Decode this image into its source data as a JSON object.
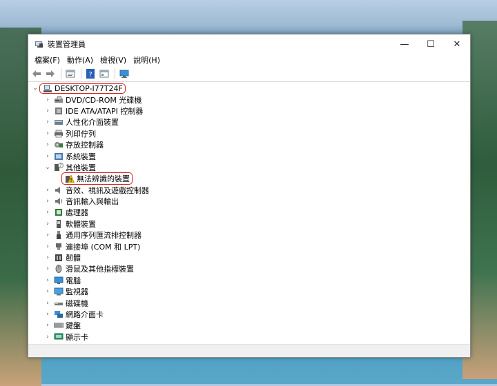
{
  "window": {
    "title": "裝置管理員",
    "controls": {
      "minimize": "—",
      "maximize": "☐",
      "close": "✕"
    }
  },
  "menu": [
    "檔案(F)",
    "動作(A)",
    "檢視(V)",
    "說明(H)"
  ],
  "toolbar": [
    "back-arrow-icon",
    "forward-arrow-icon",
    "properties-icon",
    "help-icon",
    "view-icon",
    "monitor-scan-icon"
  ],
  "tree": {
    "root": "DESKTOP-I77T24F",
    "items": [
      {
        "label": "DVD/CD-ROM 光碟機",
        "icon": "dvd-drive-icon",
        "expanded": false
      },
      {
        "label": "IDE ATA/ATAPI 控制器",
        "icon": "ide-controller-icon",
        "expanded": false
      },
      {
        "label": "人性化介面裝置",
        "icon": "hid-icon",
        "expanded": false
      },
      {
        "label": "列印佇列",
        "icon": "printer-icon",
        "expanded": false
      },
      {
        "label": "存放控制器",
        "icon": "storage-controller-icon",
        "expanded": false
      },
      {
        "label": "系統裝置",
        "icon": "system-device-icon",
        "expanded": false
      },
      {
        "label": "其他裝置",
        "icon": "other-devices-icon",
        "expanded": true,
        "children": [
          {
            "label": "無法辨識的裝置",
            "icon": "warning-device-icon"
          }
        ]
      },
      {
        "label": "音效、視訊及遊戲控制器",
        "icon": "speaker-icon",
        "expanded": false
      },
      {
        "label": "音訊輸入與輸出",
        "icon": "audio-io-icon",
        "expanded": false
      },
      {
        "label": "處理器",
        "icon": "processor-icon",
        "expanded": false
      },
      {
        "label": "軟體裝置",
        "icon": "software-device-icon",
        "expanded": false
      },
      {
        "label": "通用序列匯流排控制器",
        "icon": "usb-icon",
        "expanded": false
      },
      {
        "label": "連接埠 (COM 和 LPT)",
        "icon": "port-icon",
        "expanded": false
      },
      {
        "label": "韌體",
        "icon": "firmware-icon",
        "expanded": false
      },
      {
        "label": "滑鼠及其他指標裝置",
        "icon": "mouse-icon",
        "expanded": false
      },
      {
        "label": "電腦",
        "icon": "computer-icon",
        "expanded": false
      },
      {
        "label": "監視器",
        "icon": "monitor-icon",
        "expanded": false
      },
      {
        "label": "磁碟機",
        "icon": "disk-drive-icon",
        "expanded": false
      },
      {
        "label": "網路介面卡",
        "icon": "network-adapter-icon",
        "expanded": false
      },
      {
        "label": "鍵盤",
        "icon": "keyboard-icon",
        "expanded": false
      },
      {
        "label": "顯示卡",
        "icon": "display-adapter-icon",
        "expanded": false
      }
    ]
  },
  "colors": {
    "highlight": "#d32020",
    "accent": "#1e5aa8"
  }
}
